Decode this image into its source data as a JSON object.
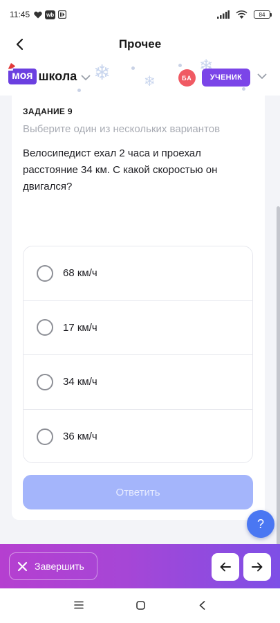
{
  "status_bar": {
    "time": "11:45",
    "badge_label": "wb",
    "battery": "84"
  },
  "header": {
    "title": "Прочее"
  },
  "brand": {
    "logo_badge": "моя",
    "logo_text": "школа",
    "avatar_initials": "БА",
    "role_label": "УЧЕНИК"
  },
  "task": {
    "label": "ЗАДАНИЕ 9",
    "hint": "Выберите один из нескольких вариантов",
    "question": "Велосипедист ехал 2 часа и проехал расстояние 34 км. С какой скоростью он двигался?",
    "options": [
      "68 км/ч",
      "17 км/ч",
      "34 км/ч",
      "36 км/ч"
    ],
    "answer_button": "Ответить"
  },
  "help_label": "?",
  "bottom": {
    "finish_label": "Завершить"
  },
  "colors": {
    "brand_purple": "#6b3fe0",
    "role_pill": "#7b45e8",
    "avatar": "#f05a63",
    "answer_disabled": "#a4b5fb",
    "help_fab": "#4a77f2",
    "bottom_gradient_start": "#b53fd0",
    "bottom_gradient_end": "#7e4fe6"
  }
}
